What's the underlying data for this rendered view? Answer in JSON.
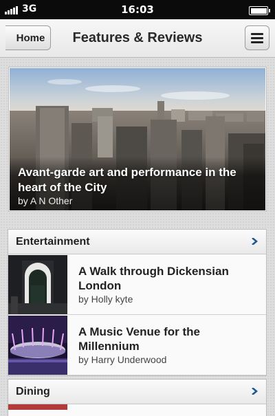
{
  "status_bar": {
    "carrier_network": "3G",
    "time": "16:03"
  },
  "nav": {
    "home_label": "Home",
    "title": "Features & Reviews"
  },
  "hero": {
    "title": "Avant-garde art and performance in the heart of the City",
    "byline": "by A N Other"
  },
  "sections": [
    {
      "label": "Entertainment",
      "articles": [
        {
          "title": "A Walk through Dickensian London",
          "byline": "by Holly kyte"
        },
        {
          "title": "A Music Venue for the Millennium",
          "byline": "by Harry Underwood"
        }
      ]
    },
    {
      "label": "Dining"
    }
  ],
  "icons": {
    "signal": "signal-bars-icon",
    "battery": "battery-icon",
    "menu": "hamburger-menu-icon",
    "chevron": "chevron-right-icon"
  },
  "colors": {
    "chevron": "#1c5a93",
    "status_bar": "#0b0b0b"
  }
}
